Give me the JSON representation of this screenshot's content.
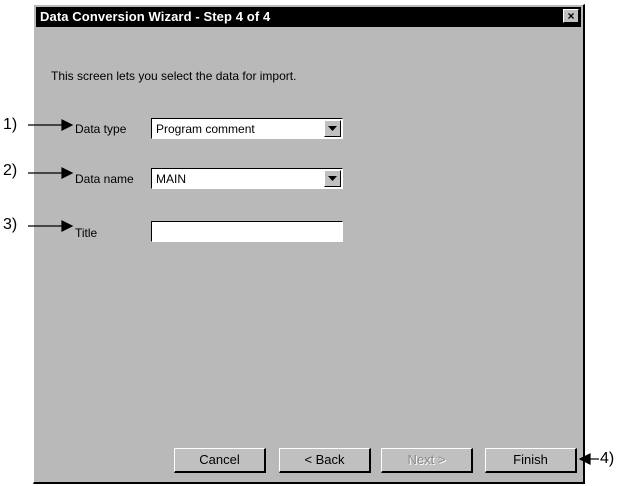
{
  "window": {
    "title": "Data Conversion Wizard - Step 4 of 4",
    "close_glyph": "×"
  },
  "intro_text": "This screen lets you select the data for import.",
  "fields": {
    "data_type": {
      "label": "Data type",
      "value": "Program comment"
    },
    "data_name": {
      "label": "Data name",
      "value": "MAIN"
    },
    "title": {
      "label": "Title",
      "value": ""
    }
  },
  "buttons": {
    "cancel": "Cancel",
    "back": "< Back",
    "next": "Next >",
    "finish": "Finish"
  },
  "callouts": [
    "1)",
    "2)",
    "3)",
    "4)"
  ],
  "icons": {
    "close": "close-icon",
    "dropdown": "chevron-down-icon",
    "arrow": "arrow-right-icon"
  }
}
